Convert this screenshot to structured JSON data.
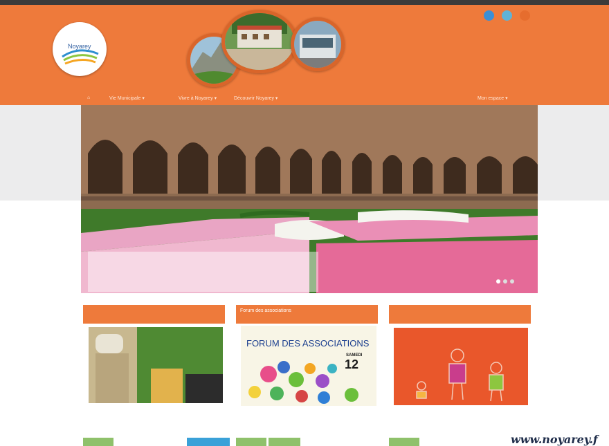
{
  "header": {
    "logo_text": "Noyarey",
    "social": [
      {
        "name": "facebook",
        "color": "#3b8fd6"
      },
      {
        "name": "twitter",
        "color": "#5fb3d6"
      },
      {
        "name": "rss",
        "color": "#e66d2e"
      }
    ]
  },
  "nav": {
    "home_icon": "home-icon",
    "items": [
      {
        "label": "Vie Municipale ▾"
      },
      {
        "label": "Vivre à Noyarey ▾"
      },
      {
        "label": "Découvrir Noyarey ▾"
      }
    ],
    "account_label": "Mon espace ▾"
  },
  "hero": {
    "caption_title": "",
    "caption_lines": [
      "",
      ""
    ]
  },
  "cards": [
    {
      "title": "",
      "text_lines": [
        "",
        "",
        ""
      ],
      "buttons": [
        {
          "label": ""
        },
        {
          "label": ""
        }
      ]
    },
    {
      "title": "Forum des associations",
      "poster_title": "FORUM DES ASSOCIATIONS",
      "poster_day_name": "SAMEDI",
      "poster_day_number": "12",
      "buttons": [
        {
          "label": ""
        },
        {
          "label": ""
        }
      ]
    },
    {
      "title": "",
      "buttons": [
        {
          "label": ""
        }
      ]
    }
  ],
  "watermark": "www.noyarey.f"
}
